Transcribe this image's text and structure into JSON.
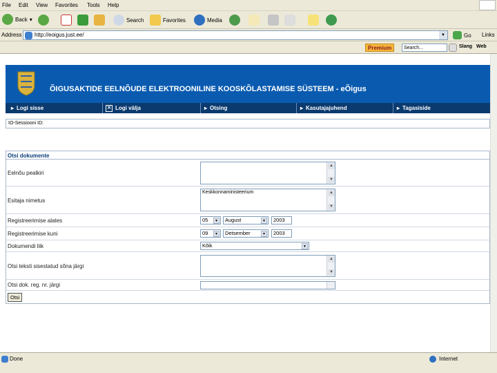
{
  "menu": [
    "File",
    "Edit",
    "View",
    "Favorites",
    "Tools",
    "Help"
  ],
  "toolbar": {
    "back": "Back",
    "search": "Search",
    "favorites": "Favorites",
    "media": "Media"
  },
  "address": {
    "label": "Address",
    "url": "http://eoigus.just.ee/",
    "go": "Go",
    "links": "Links"
  },
  "links_bar": {
    "premium": "Premium",
    "search_placeholder": "Search...",
    "slang": "Slang",
    "web": "Web"
  },
  "banner": {
    "title": "ÕIGUSAKTIDE EELNÕUDE ELEKTROONILINE KOOSKÕLASTAMISE SÜSTEEM - eÕigus"
  },
  "nav": [
    {
      "label": "Logi sisse"
    },
    {
      "label": "Logi välja"
    },
    {
      "label": "Otsing"
    },
    {
      "label": "Kasutajajuhend"
    },
    {
      "label": "Tagasiside"
    }
  ],
  "session": {
    "label": "IO-Sessiooni ID:"
  },
  "form": {
    "title": "Otsi dokumente",
    "fields": {
      "pealkiri": {
        "label": "Eelnõu pealkiri",
        "value": ""
      },
      "esitaja": {
        "label": "Esitaja nimetus",
        "value": "Keskkonnaministeerium"
      },
      "alates": {
        "label": "Registreerimise alates",
        "day": "05",
        "month": "August",
        "year": "2003"
      },
      "kuni": {
        "label": "Registreerimise kuni",
        "day": "09",
        "month": "Detsember",
        "year": "2003"
      },
      "liik": {
        "label": "Dokumendi liik",
        "value": "Kõik"
      },
      "tekst": {
        "label": "Otsi teksti sisestatud sõna järgi",
        "value": ""
      },
      "regnr": {
        "label": "Otsi dok. reg. nr. järgi",
        "value": ""
      }
    },
    "submit": "Otsi"
  },
  "status": {
    "left": "Done",
    "zone": "Internet"
  }
}
